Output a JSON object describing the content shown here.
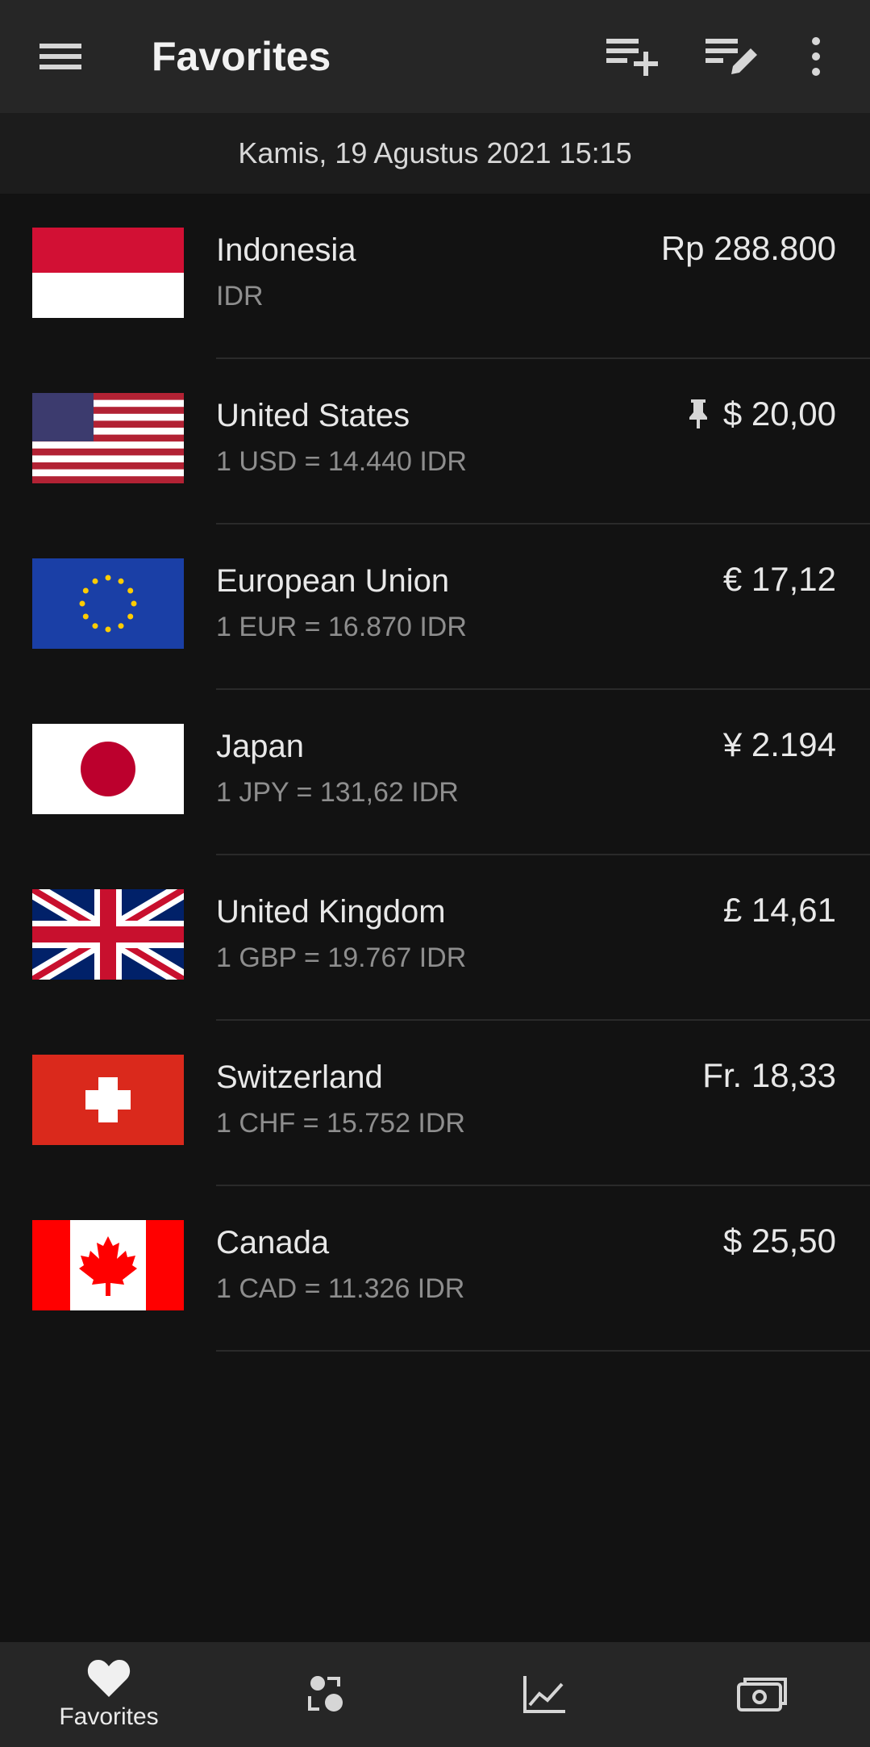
{
  "appbar": {
    "title": "Favorites",
    "menu_icon": "hamburger-menu-icon",
    "actions": [
      "playlist-add-icon",
      "playlist-edit-icon",
      "more-vert-icon"
    ]
  },
  "date_text": "Kamis, 19 Agustus 2021 15:15",
  "favorites": [
    {
      "country": "Indonesia",
      "rate": "IDR",
      "amount": "Rp 288.800",
      "flag": "indonesia-flag-icon",
      "pinned": false
    },
    {
      "country": "United States",
      "rate": "1 USD = 14.440 IDR",
      "amount": "$ 20,00",
      "flag": "usa-flag-icon",
      "pinned": true
    },
    {
      "country": "European Union",
      "rate": "1 EUR = 16.870 IDR",
      "amount": "€ 17,12",
      "flag": "eu-flag-icon",
      "pinned": false
    },
    {
      "country": "Japan",
      "rate": "1 JPY = 131,62 IDR",
      "amount": "¥ 2.194",
      "flag": "japan-flag-icon",
      "pinned": false
    },
    {
      "country": "United Kingdom",
      "rate": "1 GBP = 19.767 IDR",
      "amount": "£ 14,61",
      "flag": "uk-flag-icon",
      "pinned": false
    },
    {
      "country": "Switzerland",
      "rate": "1 CHF = 15.752 IDR",
      "amount": "Fr. 18,33",
      "flag": "switzerland-flag-icon",
      "pinned": false
    },
    {
      "country": "Canada",
      "rate": "1 CAD = 11.326 IDR",
      "amount": "$ 25,50",
      "flag": "canada-flag-icon",
      "pinned": false
    }
  ],
  "bottom_nav": [
    {
      "label": "Favorites",
      "icon": "heart-icon",
      "active": true
    },
    {
      "label": "",
      "icon": "currency-exchange-icon",
      "active": false
    },
    {
      "label": "",
      "icon": "chart-icon",
      "active": false
    },
    {
      "label": "",
      "icon": "banknote-icon",
      "active": false
    }
  ],
  "colors": {
    "appbar": "#262626",
    "background": "#121212",
    "datebar": "#1c1c1c",
    "text_primary": "#e8e8e8",
    "text_secondary": "#8e8e8e"
  }
}
